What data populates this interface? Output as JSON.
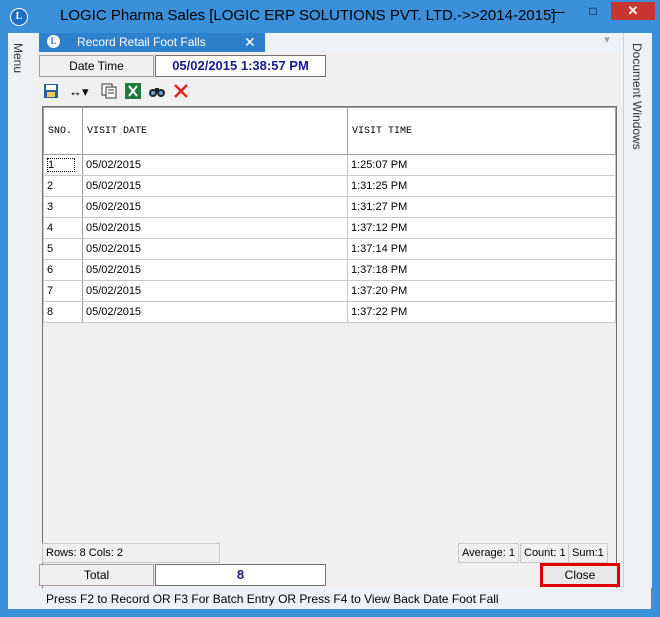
{
  "window": {
    "title": "LOGIC Pharma Sales  [LOGIC ERP SOLUTIONS PVT. LTD.->>2014-2015]",
    "minimize": "—",
    "maximize": "□",
    "close": "✕"
  },
  "side_panels": {
    "left": "Menu",
    "right": "Document Windows"
  },
  "tab": {
    "label": "Record Retail Foot Falls",
    "close": "✕"
  },
  "header": {
    "datetime_label": "Date Time",
    "datetime_value": "05/02/2015 1:38:57 PM"
  },
  "toolbar": [
    "save-layout-icon",
    "column-width-icon",
    "copy-icon",
    "excel-export-icon",
    "find-icon",
    "delete-icon"
  ],
  "grid": {
    "columns": [
      "SNO.",
      "VISIT DATE",
      "VISIT TIME"
    ],
    "rows": [
      [
        "1",
        "05/02/2015",
        "1:25:07 PM"
      ],
      [
        "2",
        "05/02/2015",
        "1:31:25 PM"
      ],
      [
        "3",
        "05/02/2015",
        "1:31:27 PM"
      ],
      [
        "4",
        "05/02/2015",
        "1:37:12 PM"
      ],
      [
        "5",
        "05/02/2015",
        "1:37:14 PM"
      ],
      [
        "6",
        "05/02/2015",
        "1:37:18 PM"
      ],
      [
        "7",
        "05/02/2015",
        "1:37:20 PM"
      ],
      [
        "8",
        "05/02/2015",
        "1:37:22 PM"
      ]
    ]
  },
  "status": {
    "rows_cols": "Rows: 8  Cols: 2",
    "average": "Average: 1",
    "count": "Count: 1",
    "sum": "Sum:1"
  },
  "footer": {
    "total_label": "Total",
    "total_value": "8",
    "close_button": "Close",
    "hint": "Press F2 to Record  OR F3 For Batch Entry OR Press F4 to View Back Date Foot Fall"
  },
  "colors": {
    "accent": "#3c8fd9",
    "tab": "#2f80cc",
    "highlight_border": "#e00000",
    "value_text": "#1a1a8c"
  }
}
